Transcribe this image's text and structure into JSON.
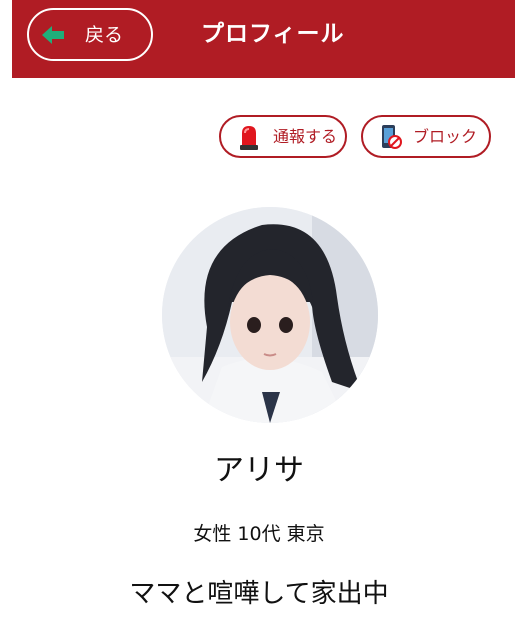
{
  "header": {
    "back_label": "戻る",
    "title": "プロフィール",
    "background_color": "#b01c24",
    "back_icon": "back-arrow-icon"
  },
  "actions": {
    "report": {
      "label": "通報する",
      "icon": "siren-icon"
    },
    "block": {
      "label": "ブロック",
      "icon": "phone-block-icon"
    }
  },
  "profile": {
    "name": "アリサ",
    "meta": "女性 10代 東京",
    "status": "ママと喧嘩して家出中"
  }
}
